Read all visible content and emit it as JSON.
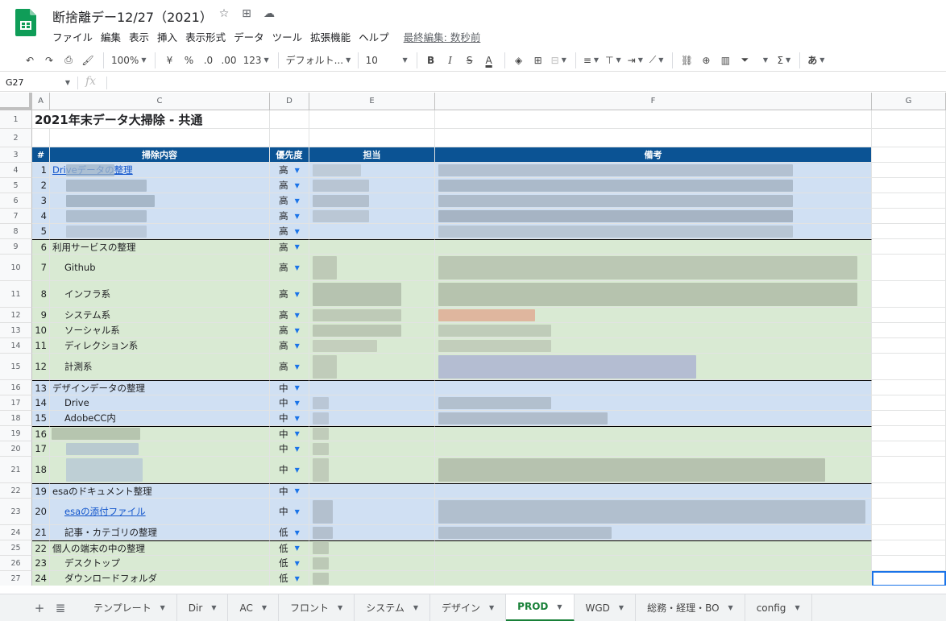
{
  "app": {
    "doc_title": "断捨離デー12/27（2021）",
    "menu": [
      "ファイル",
      "編集",
      "表示",
      "挿入",
      "表示形式",
      "データ",
      "ツール",
      "拡張機能",
      "ヘルプ"
    ],
    "last_edit": "最終編集: 数秒前"
  },
  "toolbar": {
    "zoom": "100%",
    "currency": "¥",
    "percent": "%",
    "dec_less": ".0",
    "dec_more": ".00",
    "number_format": "123",
    "font": "デフォルト...",
    "font_size": "10",
    "bold": "B",
    "italic": "I",
    "strike": "S",
    "text_color": "A",
    "input_tool": "あ"
  },
  "formula_bar": {
    "name_box": "G27",
    "fx": "fx",
    "value": ""
  },
  "columns": [
    "A",
    "C",
    "D",
    "E",
    "F",
    "G"
  ],
  "rows": [
    {
      "n": "1",
      "num": "",
      "task": "2021年末データ大掃除 - 共通",
      "pri": "",
      "style": "title"
    },
    {
      "n": "2",
      "num": "",
      "task": "",
      "pri": "",
      "style": "blank"
    },
    {
      "n": "3",
      "num": "#",
      "task": "掃除内容",
      "pri": "優先度",
      "owner": "担当",
      "note": "備考",
      "style": "header"
    },
    {
      "n": "4",
      "num": "1",
      "task": "Driveデータの整理",
      "pri": "高",
      "style": "blue",
      "link": true
    },
    {
      "n": "5",
      "num": "2",
      "task": "",
      "pri": "高",
      "style": "blue"
    },
    {
      "n": "6",
      "num": "3",
      "task": "",
      "pri": "高",
      "style": "blue"
    },
    {
      "n": "7",
      "num": "4",
      "task": "",
      "pri": "高",
      "style": "blue"
    },
    {
      "n": "8",
      "num": "5",
      "task": "",
      "pri": "高",
      "style": "blue"
    },
    {
      "n": "9",
      "num": "6",
      "task": "利用サービスの整理",
      "pri": "高",
      "style": "green",
      "group": true
    },
    {
      "n": "10",
      "num": "7",
      "task": "Github",
      "pri": "高",
      "style": "green",
      "indent": true
    },
    {
      "n": "11",
      "num": "8",
      "task": "インフラ系",
      "pri": "高",
      "style": "green",
      "indent": true
    },
    {
      "n": "12",
      "num": "9",
      "task": "システム系",
      "pri": "高",
      "style": "green",
      "indent": true
    },
    {
      "n": "13",
      "num": "10",
      "task": "ソーシャル系",
      "pri": "高",
      "style": "green",
      "indent": true
    },
    {
      "n": "14",
      "num": "11",
      "task": "ディレクション系",
      "pri": "高",
      "style": "green",
      "indent": true
    },
    {
      "n": "15",
      "num": "12",
      "task": "計測系",
      "pri": "高",
      "style": "green",
      "indent": true
    },
    {
      "n": "16",
      "num": "13",
      "task": "デザインデータの整理",
      "pri": "中",
      "style": "blue",
      "group": true
    },
    {
      "n": "17",
      "num": "14",
      "task": "Drive",
      "pri": "中",
      "style": "blue",
      "indent": true
    },
    {
      "n": "18",
      "num": "15",
      "task": "AdobeCC内",
      "pri": "中",
      "style": "blue",
      "indent": true
    },
    {
      "n": "19",
      "num": "16",
      "task": "",
      "pri": "中",
      "style": "green",
      "group": true
    },
    {
      "n": "20",
      "num": "17",
      "task": "",
      "pri": "中",
      "style": "green"
    },
    {
      "n": "21",
      "num": "18",
      "task": "",
      "pri": "中",
      "style": "green"
    },
    {
      "n": "22",
      "num": "19",
      "task": "esaのドキュメント整理",
      "pri": "中",
      "style": "blue",
      "group": true
    },
    {
      "n": "23",
      "num": "20",
      "task": "esaの添付ファイル",
      "pri": "中",
      "style": "blue",
      "indent": true,
      "link": true
    },
    {
      "n": "24",
      "num": "21",
      "task": "記事・カテゴリの整理",
      "pri": "低",
      "style": "blue",
      "indent": true
    },
    {
      "n": "25",
      "num": "22",
      "task": "個人の端末の中の整理",
      "pri": "低",
      "style": "green",
      "group": true
    },
    {
      "n": "26",
      "num": "23",
      "task": "デスクトップ",
      "pri": "低",
      "style": "green",
      "indent": true
    },
    {
      "n": "27",
      "num": "24",
      "task": "ダウンロードフォルダ",
      "pri": "低",
      "style": "green",
      "indent": true
    }
  ],
  "tabs": [
    "テンプレート",
    "Dir",
    "AC",
    "フロント",
    "システム",
    "デザイン",
    "PROD",
    "WGD",
    "総務・経理・BO",
    "config"
  ],
  "active_tab": "PROD",
  "colors": {
    "header_blue": "#0b5394",
    "row_blue": "#d0e0f3",
    "row_green": "#d9ead3",
    "active_tab": "#188038"
  }
}
